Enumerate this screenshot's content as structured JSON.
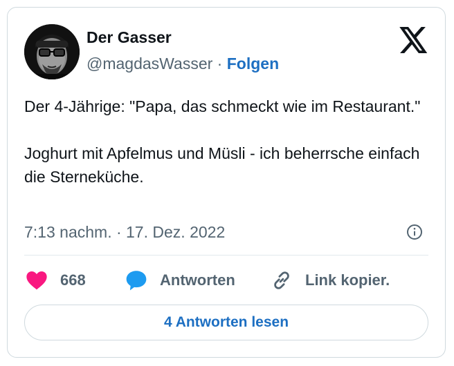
{
  "author": {
    "name": "Der Gasser",
    "handle": "@magdasWasser",
    "separator": "·",
    "follow_label": "Folgen"
  },
  "platform_icon": "x-logo-icon",
  "tweet": {
    "paragraphs": [
      "Der 4-Jährige: \"Papa, das schmeckt wie im Restaurant.\"",
      "Joghurt mit Apfelmus und Müsli - ich beherrsche einfach die Sterneküche."
    ],
    "timestamp": "7:13 nachm. · 17. Dez. 2022"
  },
  "actions": {
    "like": {
      "icon": "heart-icon",
      "count": "668"
    },
    "reply": {
      "icon": "speech-bubble-icon",
      "label": "Antworten"
    },
    "copy": {
      "icon": "link-icon",
      "label": "Link kopier."
    }
  },
  "read_replies_label": "4 Antworten lesen",
  "colors": {
    "link_blue": "#1d6fc2",
    "like_pink": "#f91880",
    "reply_blue": "#1d9bf0",
    "secondary_text": "#536471",
    "border": "#cfd9de"
  }
}
